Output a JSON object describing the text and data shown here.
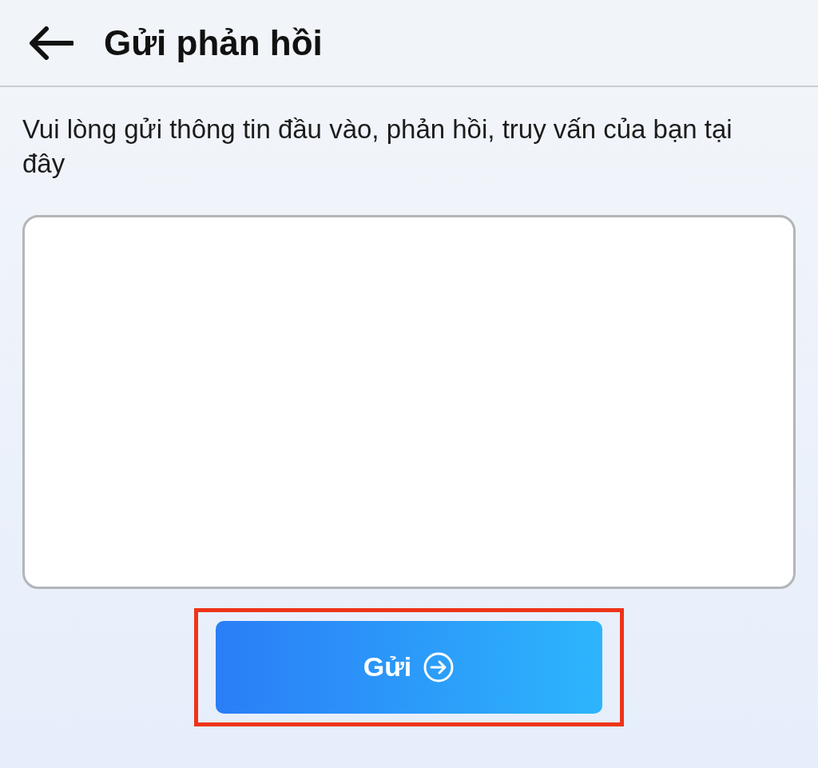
{
  "header": {
    "title": "Gửi phản hồi"
  },
  "instruction": "Vui lòng gửi thông tin đầu vào, phản hồi, truy vấn của bạn tại đây",
  "submit_button": {
    "label": "Gửi",
    "highlighted": true
  }
}
